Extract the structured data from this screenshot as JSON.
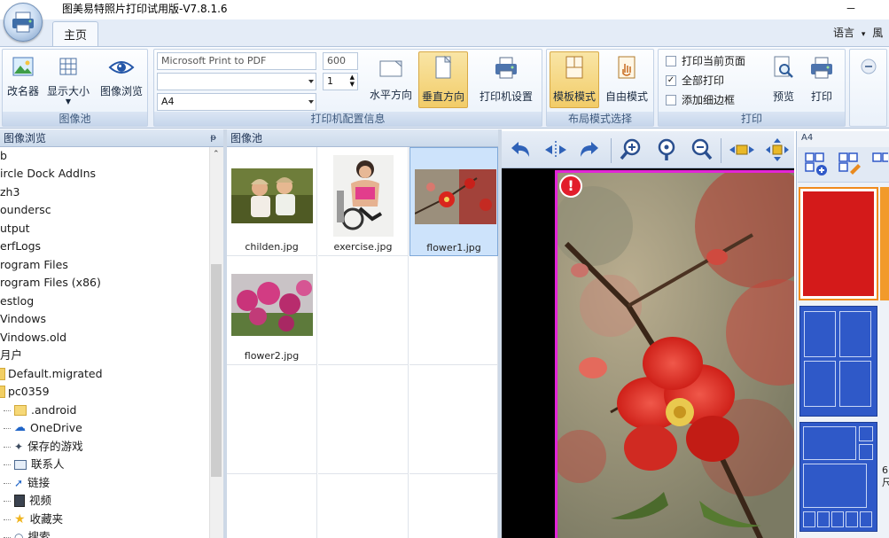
{
  "app": {
    "title": "图美易特照片打印试用版-V7.8.1.6",
    "minimize": "－"
  },
  "tabs": [
    {
      "label": "主页"
    }
  ],
  "language": {
    "label": "语言",
    "arrow": "▾",
    "extra": "風"
  },
  "ribbon": {
    "image_pool": {
      "label": "图像池",
      "rename": "改名器",
      "display_size": "显示大小",
      "image_browse": "图像浏览"
    },
    "printer_config": {
      "label": "打印机配置信息",
      "printer": "Microsoft Print to PDF",
      "dpi": "600",
      "copies": "1",
      "second": "",
      "paper": "A4",
      "horizontal": "水平方向",
      "vertical": "垂直方向",
      "printer_settings": "打印机设置"
    },
    "layout_mode": {
      "label": "布局模式选择",
      "template": "模板模式",
      "free": "自由模式"
    },
    "print": {
      "label": "打印",
      "print_current": "打印当前页面",
      "print_all": "全部打印",
      "add_border": "添加细边框",
      "preview": "预览",
      "print_button": "打印",
      "print_all_checked": "✓"
    }
  },
  "tree_panel": {
    "title": "图像浏览",
    "pin": "ᵽ",
    "items": [
      {
        "label": "b"
      },
      {
        "label": "ircle Dock AddIns"
      },
      {
        "label": "zh3"
      },
      {
        "label": "oundersc"
      },
      {
        "label": "utput"
      },
      {
        "label": "erfLogs"
      },
      {
        "label": "rogram Files"
      },
      {
        "label": "rogram Files (x86)"
      },
      {
        "label": "estlog"
      },
      {
        "label": "Vindows"
      },
      {
        "label": "Vindows.old"
      },
      {
        "label": "月户"
      },
      {
        "label": "Default.migrated"
      },
      {
        "label": "pc0359"
      },
      {
        "label": ".android"
      },
      {
        "label": "OneDrive"
      },
      {
        "label": "保存的游戏"
      },
      {
        "label": "联系人"
      },
      {
        "label": "链接"
      },
      {
        "label": "视频"
      },
      {
        "label": "收藏夹"
      },
      {
        "label": "搜索"
      }
    ]
  },
  "image_pool": {
    "title": "图像池",
    "files": [
      {
        "name": "childen.jpg"
      },
      {
        "name": "exercise.jpg"
      },
      {
        "name": "flower1.jpg"
      },
      {
        "name": "flower2.jpg"
      }
    ]
  },
  "preview": {
    "alert": "!"
  },
  "layouts": {
    "title": "A4",
    "side_text_1": "6",
    "side_text_2": "尺"
  },
  "colors": {
    "accent_red": "#d41a1a",
    "layout_blue": "#2f59c8",
    "page_border": "#e324d7",
    "selection": "#cde3fb"
  }
}
